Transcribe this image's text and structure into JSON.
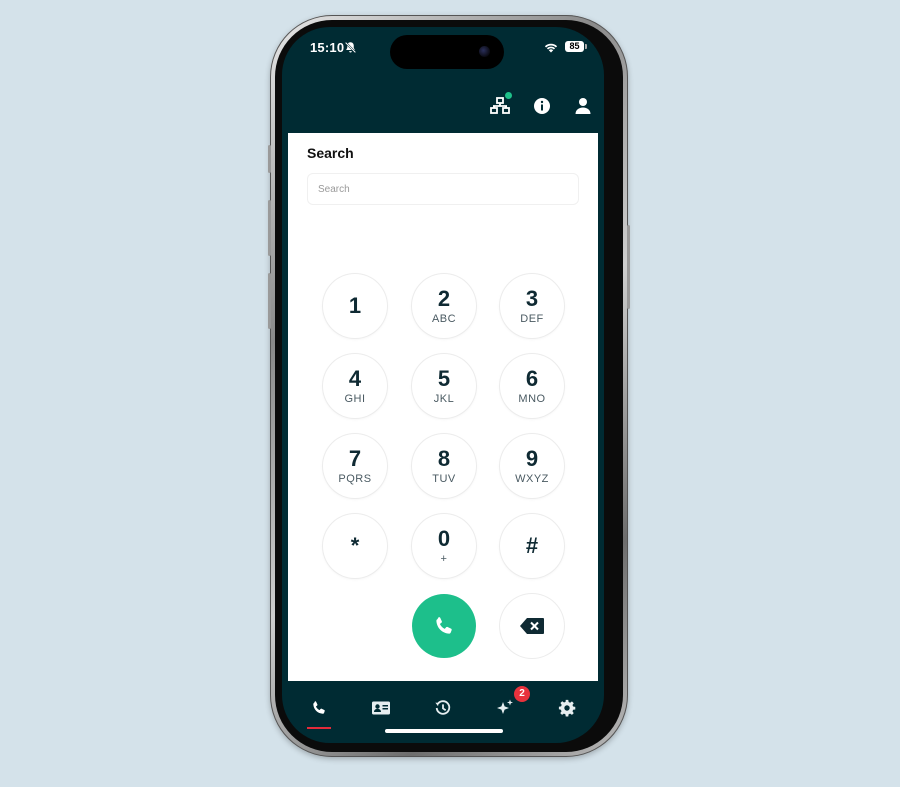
{
  "status": {
    "time": "15:10",
    "battery": "85"
  },
  "search": {
    "title": "Search",
    "placeholder": "Search",
    "value": ""
  },
  "keypad": [
    {
      "digit": "1",
      "letters": ""
    },
    {
      "digit": "2",
      "letters": "ABC"
    },
    {
      "digit": "3",
      "letters": "DEF"
    },
    {
      "digit": "4",
      "letters": "GHI"
    },
    {
      "digit": "5",
      "letters": "JKL"
    },
    {
      "digit": "6",
      "letters": "MNO"
    },
    {
      "digit": "7",
      "letters": "PQRS"
    },
    {
      "digit": "8",
      "letters": "TUV"
    },
    {
      "digit": "9",
      "letters": "WXYZ"
    },
    {
      "digit": "*",
      "letters": ""
    },
    {
      "digit": "0",
      "letters": "+"
    },
    {
      "digit": "#",
      "letters": ""
    }
  ],
  "tabs": {
    "active": "dialer",
    "items": [
      "dialer",
      "contacts",
      "history",
      "ai",
      "settings"
    ],
    "ai_badge": "2"
  },
  "icons": {
    "header": [
      "network-icon",
      "info-icon",
      "user-icon"
    ],
    "actions": [
      "phone-icon",
      "backspace-icon"
    ]
  },
  "colors": {
    "header_bg": "#002b33",
    "call_green": "#1dbf8b",
    "badge_red": "#e8323d",
    "status_dot": "#1ec089"
  }
}
